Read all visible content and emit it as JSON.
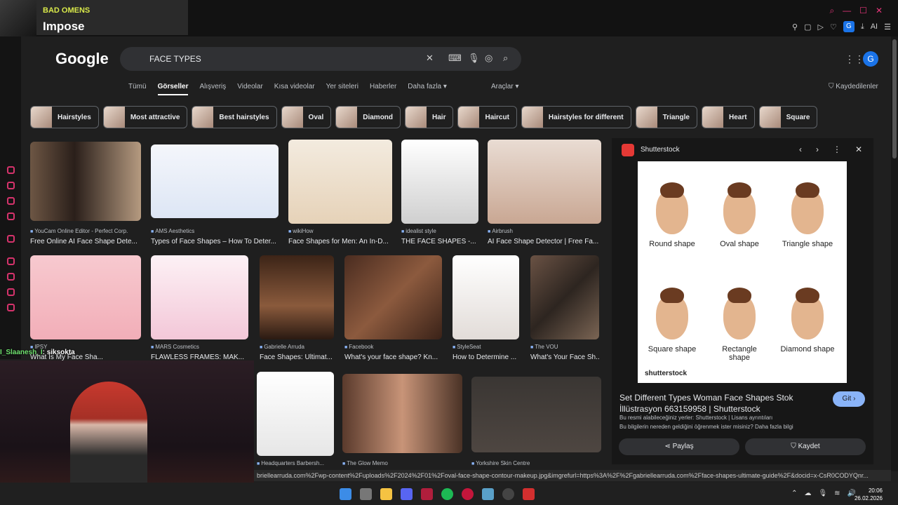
{
  "now_playing": {
    "artist": "BAD OMENS",
    "song": "Impose"
  },
  "browser": {
    "profile_initial": "G",
    "ai_label": "AI"
  },
  "google": {
    "logo": "Google",
    "query": "FACE TYPES",
    "avatar": "G",
    "tabs": [
      "Tümü",
      "Görseller",
      "Alışveriş",
      "Videolar",
      "Kısa videolar",
      "Yer siteleri",
      "Haberler",
      "Daha fazla"
    ],
    "active_tab": "Görseller",
    "tools": "Araçlar",
    "saved": "Kaydedilenler"
  },
  "chips": [
    "Hairstyles",
    "Most attractive",
    "Best hairstyles",
    "Oval",
    "Diamond",
    "Hair",
    "Haircut",
    "Hairstyles for different",
    "Triangle",
    "Heart",
    "Square"
  ],
  "results": [
    {
      "source": "YouCam Online Editor - Perfect Corp.",
      "caption": "Free Online AI Face Shape Dete..."
    },
    {
      "source": "AMS Aesthetics",
      "caption": "Types of Face Shapes – How To Deter..."
    },
    {
      "source": "wikiHow",
      "caption": "Face Shapes for Men: An In-D..."
    },
    {
      "source": "idealist style",
      "caption": "THE FACE SHAPES -..."
    },
    {
      "source": "Airbrush",
      "caption": "AI Face Shape Detector | Free Fa..."
    },
    {
      "source": "IPSY",
      "caption": "What Is My Face Sha..."
    },
    {
      "source": "MARS Cosmetics",
      "caption": "FLAWLESS FRAMES: MAK..."
    },
    {
      "source": "Gabrielle Arruda",
      "caption": "Face Shapes: Ultimat..."
    },
    {
      "source": "Facebook",
      "caption": "What's your face shape? Kn..."
    },
    {
      "source": "StyleSeat",
      "caption": "How to Determine ..."
    },
    {
      "source": "The VOU",
      "caption": "What's Your Face Sh..."
    },
    {
      "source": "Headquarters Barbersh...",
      "caption": ""
    },
    {
      "source": "The Glow Memo",
      "caption": ""
    },
    {
      "source": "Yorkshire Skin Centre",
      "caption": ""
    }
  ],
  "preview": {
    "source": "Shutterstock",
    "shapes": [
      "Round shape",
      "Oval shape",
      "Triangle shape",
      "Square shape",
      "Rectangle shape",
      "Diamond shape"
    ],
    "watermark": "shutterstock",
    "title": "Set Different Types Woman Face Shapes Stok İllüstrasyon 663159958 | Shutterstock",
    "go": "Git",
    "license": "Bu resmi alabileceğiniz yerler: Shutterstock | Lisans ayrıntıları",
    "info": "Bu bilgilerin nereden geldiğini öğrenmek ister misiniz? Daha fazla bilgi",
    "share": "Paylaş",
    "save": "Kaydet"
  },
  "chat": {
    "user": "I_Slaanesh_I",
    "message": ": siksokta"
  },
  "status_url": "briellearruda.com%2Fwp-content%2Fuploads%2F2024%2F01%2Foval-face-shape-contour-makeup.jpg&imgrefurl=https%3A%2F%2Fgabriellearruda.com%2Fface-shapes-ultimate-guide%2F&docid=x-CsR0CODYQnr...",
  "clock": {
    "time": "20:06",
    "date": "26.02.2026"
  },
  "accent": "#e6357a"
}
